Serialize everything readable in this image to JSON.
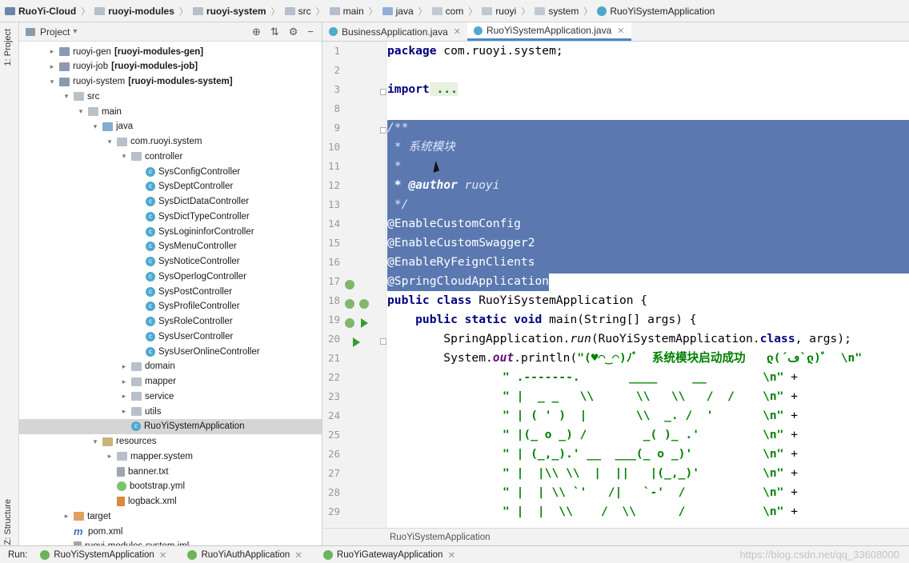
{
  "breadcrumb": [
    "RuoYi-Cloud",
    "ruoyi-modules",
    "ruoyi-system",
    "src",
    "main",
    "java",
    "com",
    "ruoyi",
    "system",
    "RuoYiSystemApplication"
  ],
  "side_tabs": {
    "project": "1: Project",
    "structure": "Z: Structure"
  },
  "project_panel": {
    "title": "Project",
    "tree": [
      {
        "label": "ruoyi-gen",
        "module": "[ruoyi-modules-gen]",
        "arrow": "›",
        "icon": "module-folder-icon",
        "name": "tree-item-ruoyi-gen"
      },
      {
        "label": "ruoyi-job",
        "module": "[ruoyi-modules-job]",
        "arrow": "›",
        "icon": "module-folder-icon",
        "name": "tree-item-ruoyi-job"
      },
      {
        "label": "ruoyi-system",
        "module": "[ruoyi-modules-system]",
        "arrow": "⌄",
        "icon": "module-folder-icon",
        "name": "tree-item-ruoyi-system"
      },
      {
        "label": "src",
        "module": "",
        "arrow": "⌄",
        "icon": "folder-icon",
        "name": "tree-item-src"
      },
      {
        "label": "main",
        "module": "",
        "arrow": "⌄",
        "icon": "folder-icon",
        "name": "tree-item-main"
      },
      {
        "label": "java",
        "module": "",
        "arrow": "⌄",
        "icon": "source-folder-icon",
        "name": "tree-item-java"
      },
      {
        "label": "com.ruoyi.system",
        "module": "",
        "arrow": "⌄",
        "icon": "package-icon",
        "name": "tree-item-package"
      },
      {
        "label": "controller",
        "module": "",
        "arrow": "⌄",
        "icon": "package-icon",
        "name": "tree-item-controller"
      },
      {
        "label": "SysConfigController",
        "module": "",
        "arrow": "",
        "icon": "class-icon",
        "name": "tree-item-class"
      },
      {
        "label": "SysDeptController",
        "module": "",
        "arrow": "",
        "icon": "class-icon",
        "name": "tree-item-class"
      },
      {
        "label": "SysDictDataController",
        "module": "",
        "arrow": "",
        "icon": "class-icon",
        "name": "tree-item-class"
      },
      {
        "label": "SysDictTypeController",
        "module": "",
        "arrow": "",
        "icon": "class-icon",
        "name": "tree-item-class"
      },
      {
        "label": "SysLogininforController",
        "module": "",
        "arrow": "",
        "icon": "class-icon",
        "name": "tree-item-class"
      },
      {
        "label": "SysMenuController",
        "module": "",
        "arrow": "",
        "icon": "class-icon",
        "name": "tree-item-class"
      },
      {
        "label": "SysNoticeController",
        "module": "",
        "arrow": "",
        "icon": "class-icon",
        "name": "tree-item-class"
      },
      {
        "label": "SysOperlogController",
        "module": "",
        "arrow": "",
        "icon": "class-icon",
        "name": "tree-item-class"
      },
      {
        "label": "SysPostController",
        "module": "",
        "arrow": "",
        "icon": "class-icon",
        "name": "tree-item-class"
      },
      {
        "label": "SysProfileController",
        "module": "",
        "arrow": "",
        "icon": "class-icon",
        "name": "tree-item-class"
      },
      {
        "label": "SysRoleController",
        "module": "",
        "arrow": "",
        "icon": "class-icon",
        "name": "tree-item-class"
      },
      {
        "label": "SysUserController",
        "module": "",
        "arrow": "",
        "icon": "class-icon",
        "name": "tree-item-class"
      },
      {
        "label": "SysUserOnlineController",
        "module": "",
        "arrow": "",
        "icon": "class-icon",
        "name": "tree-item-class"
      },
      {
        "label": "domain",
        "module": "",
        "arrow": "›",
        "icon": "package-icon",
        "name": "tree-item-domain"
      },
      {
        "label": "mapper",
        "module": "",
        "arrow": "›",
        "icon": "package-icon",
        "name": "tree-item-mapper"
      },
      {
        "label": "service",
        "module": "",
        "arrow": "›",
        "icon": "package-icon",
        "name": "tree-item-service"
      },
      {
        "label": "utils",
        "module": "",
        "arrow": "›",
        "icon": "package-icon",
        "name": "tree-item-utils"
      },
      {
        "label": "RuoYiSystemApplication",
        "module": "",
        "arrow": "",
        "icon": "spring-class-icon",
        "name": "tree-item-ruoyisystemapplication"
      },
      {
        "label": "resources",
        "module": "",
        "arrow": "⌄",
        "icon": "resources-folder-icon",
        "name": "tree-item-resources"
      },
      {
        "label": "mapper.system",
        "module": "",
        "arrow": "›",
        "icon": "folder-icon",
        "name": "tree-item-mapper-system"
      },
      {
        "label": "banner.txt",
        "module": "",
        "arrow": "",
        "icon": "text-file-icon",
        "name": "tree-item-banner"
      },
      {
        "label": "bootstrap.yml",
        "module": "",
        "arrow": "",
        "icon": "yml-file-icon",
        "name": "tree-item-bootstrap"
      },
      {
        "label": "logback.xml",
        "module": "",
        "arrow": "",
        "icon": "xml-file-icon",
        "name": "tree-item-logback"
      },
      {
        "label": "target",
        "module": "",
        "arrow": "›",
        "icon": "target-folder-icon",
        "name": "tree-item-target"
      },
      {
        "label": "pom.xml",
        "module": "",
        "arrow": "",
        "icon": "maven-icon",
        "name": "tree-item-pom"
      },
      {
        "label": "ruoyi-modules-system.iml",
        "module": "",
        "arrow": "",
        "icon": "iml-file-icon",
        "name": "tree-item-iml"
      }
    ]
  },
  "editor": {
    "tabs": [
      {
        "label": "BusinessApplication.java",
        "active": false
      },
      {
        "label": "RuoYiSystemApplication.java",
        "active": true
      }
    ],
    "line_numbers": [
      "1",
      "2",
      "3",
      "8",
      "9",
      "10",
      "11",
      "12",
      "13",
      "14",
      "15",
      "16",
      "17",
      "18",
      "19",
      "20",
      "21",
      "22",
      "23",
      "24",
      "25",
      "26",
      "27",
      "28",
      "29"
    ],
    "code": {
      "l1_kw": "package",
      "l1_rest": " com.ruoyi.system;",
      "l3_kw": "import",
      "l3_rest": " ...",
      "l9": "/**",
      "l10": " * 系统模块",
      "l11": " *",
      "l12_tag": " * @author",
      "l12_rest": " ruoyi",
      "l13": " */",
      "l14": "@EnableCustomConfig",
      "l15": "@EnableCustomSwagger2",
      "l16": "@EnableRyFeignClients",
      "l17": "@SpringCloudApplication",
      "l18_kw": "public class",
      "l18_rest": " RuoYiSystemApplication {",
      "l19_kw": "    public static void",
      "l19_rest": " main(String[] args) {",
      "l20_a": "        SpringApplication.",
      "l20_m": "run",
      "l20_b": "(RuoYiSystemApplication.",
      "l20_kw": "class",
      "l20_c": ", args);",
      "l21_a": "        System.",
      "l21_f": "out",
      "l21_b": ".println(",
      "l21_s": "\"(♥◠‿◠)ﾉﾞ  系统模块启动成功   ლ(´ڡ`ლ)ﾞ  \\n\"",
      "l22_s": "\" .-------.       ____     __        \\n\"",
      "l22_p": " +",
      "l23_s": "\" |  _ _   \\\\      \\\\   \\\\   /  /    \\n\"",
      "l23_p": " +",
      "l24_s": "\" | ( ' )  |       \\\\  _. /  '       \\n\"",
      "l24_p": " +",
      "l25_s": "\" |(_ o _) /        _( )_ .'         \\n\"",
      "l25_p": " +",
      "l26_s": "\" | (_,_).' __  ___(_ o _)'          \\n\"",
      "l26_p": " +",
      "l27_s": "\" |  |\\\\ \\\\  |  ||   |(_,_)'         \\n\"",
      "l27_p": " +",
      "l28_s": "\" |  | \\\\ `'   /|   `-'  /           \\n\"",
      "l28_p": " +",
      "l29_s": "\" |  |  \\\\    /  \\\\      /           \\n\"",
      "l29_p": " +"
    },
    "status_crumb": "RuoYiSystemApplication"
  },
  "run_bar": {
    "label": "Run:",
    "tabs": [
      "RuoYiSystemApplication",
      "RuoYiAuthApplication",
      "RuoYiGatewayApplication"
    ]
  },
  "watermark": "https://blog.csdn.net/qq_33608000",
  "colors": {
    "selection": "#5b79b0",
    "keyword": "#000080",
    "string": "#008000",
    "annotation": "#808000",
    "comment": "#8c8c8c"
  }
}
